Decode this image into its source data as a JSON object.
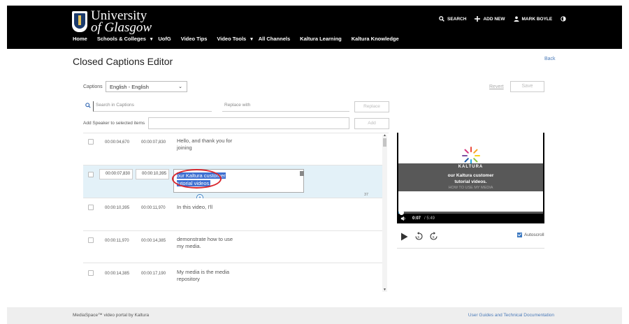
{
  "header": {
    "logo_line1": "University",
    "logo_line2": "of Glasgow",
    "nav": [
      {
        "label": "Home"
      },
      {
        "label": "Schools & Colleges",
        "caret": "▾"
      },
      {
        "label": "UofG"
      },
      {
        "label": "Video Tips"
      },
      {
        "label": "Video Tools",
        "caret": "▾"
      },
      {
        "label": "All Channels"
      },
      {
        "label": "Kaltura Learning"
      },
      {
        "label": "Kaltura Knowledge"
      }
    ],
    "search_label": "SEARCH",
    "add_new_label": "ADD NEW",
    "user_label": "MARK BOYLE",
    "icons": [
      "search-icon",
      "plus-icon",
      "user-icon",
      "contrast-icon",
      "chevron-down-icon"
    ]
  },
  "page": {
    "title": "Closed Captions Editor",
    "back_label": "Back"
  },
  "toolbar": {
    "captions_label": "Captions",
    "captions_value": "English - English",
    "revert_label": "Revert",
    "save_label": "Save",
    "search_placeholder": "Search in Captions",
    "replace_placeholder": "Replace with",
    "replace_label": "Replace",
    "speaker_label": "Add Speaker to selected items",
    "add_label": "Add"
  },
  "captions": [
    {
      "start": "00:00:04,670",
      "end": "00:00:07,830",
      "text": "Hello, and thank you for joining"
    },
    {
      "start": "00:00:07,830",
      "end": "00:00:10,395",
      "line1": "our Kaltura customer",
      "line2": "tutorial videos.",
      "char_count": "37",
      "active": true
    },
    {
      "start": "00:00:10,395",
      "end": "00:00:11,970",
      "text": "In this video, I'll"
    },
    {
      "start": "00:00:11,970",
      "end": "00:00:14,385",
      "text": "demonstrate how to use my media."
    },
    {
      "start": "00:00:14,385",
      "end": "00:00:17,190",
      "text": "My media is the media repository"
    }
  ],
  "player": {
    "overlay_title": "KALTURA",
    "overlay_line1": "our Kaltura customer",
    "overlay_line2": "tutorial videos.",
    "overlay_sub": "HOW TO USE MY MEDIA",
    "current_time": "0:07",
    "duration": "/ 5:49",
    "progress": 0.02,
    "autoscroll_label": "Autoscroll",
    "accent": "#6ab3e6"
  },
  "footer": {
    "left": "MediaSpace™ video portal by Kaltura",
    "right": "User Guides and Technical Documentation"
  }
}
